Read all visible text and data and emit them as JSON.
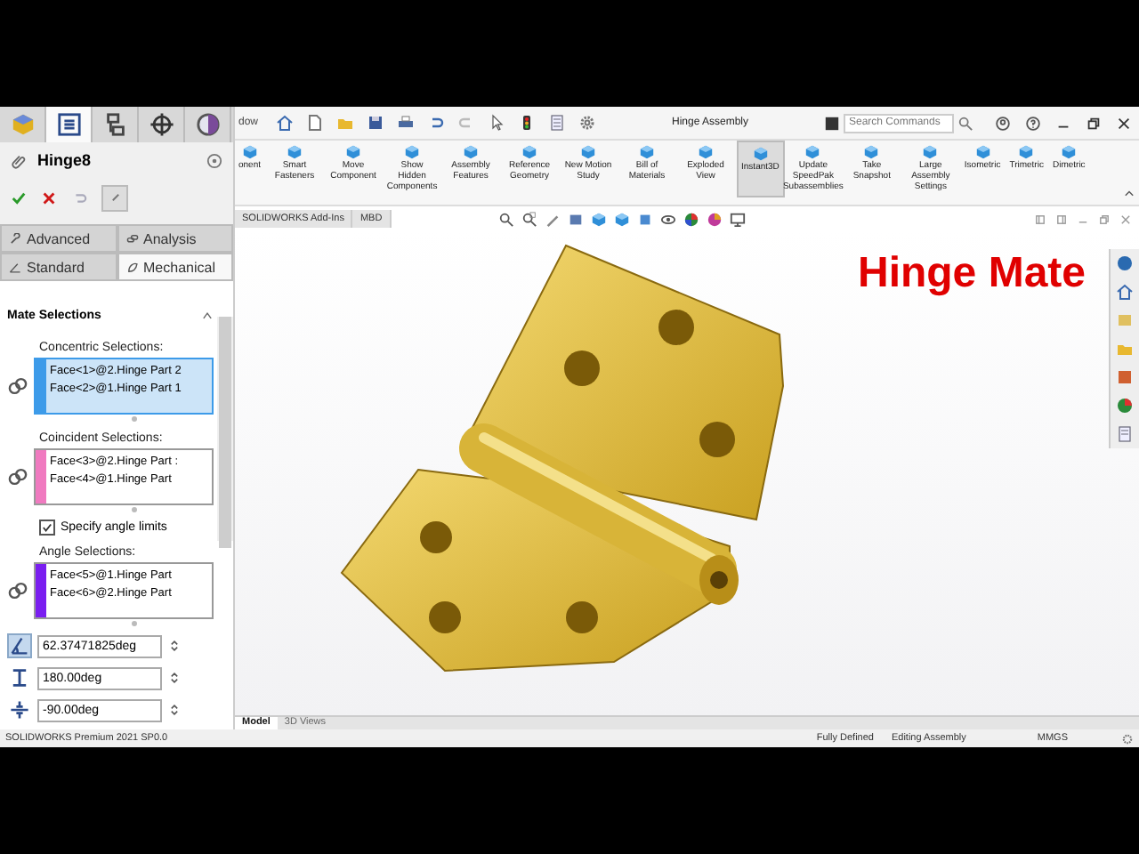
{
  "menu_fragment": "dow",
  "title": "Hinge Assembly",
  "search": {
    "placeholder": "Search Commands"
  },
  "panel_tabs": [
    {
      "kind": "feature",
      "selected": false
    },
    {
      "kind": "property",
      "selected": true
    },
    {
      "kind": "config",
      "selected": false
    },
    {
      "kind": "dim",
      "selected": false
    },
    {
      "kind": "display",
      "selected": false
    }
  ],
  "feature": {
    "title": "Hinge8"
  },
  "mate_tabs": [
    {
      "label": "Advanced",
      "kind": "advanced",
      "selected": false
    },
    {
      "label": "Analysis",
      "kind": "analysis",
      "selected": false
    },
    {
      "label": "Standard",
      "kind": "standard",
      "selected": false
    },
    {
      "label": "Mechanical",
      "kind": "mechanical",
      "selected": true
    }
  ],
  "section": {
    "title": "Mate Selections",
    "expanded": true
  },
  "selections": [
    {
      "kind": "group",
      "label": "Concentric Selections:",
      "color": "#3d9be9",
      "selected": true,
      "items": [
        "Face<1>@2.Hinge Part 2",
        "Face<2>@1.Hinge Part 1"
      ]
    },
    {
      "kind": "group",
      "label": "Coincident Selections:",
      "color": "#f07ac0",
      "selected": false,
      "items": [
        "Face<3>@2.Hinge Part :",
        "Face<4>@1.Hinge Part"
      ]
    },
    {
      "kind": "checkbox",
      "label": "Specify angle limits",
      "checked": true
    },
    {
      "kind": "group",
      "label": "Angle Selections:",
      "color": "#7a1ef0",
      "selected": false,
      "items": [
        "Face<5>@1.Hinge Part",
        "Face<6>@2.Hinge Part"
      ]
    }
  ],
  "values": [
    {
      "kind": "angle",
      "value": "62.37471825deg",
      "selected": true
    },
    {
      "kind": "max",
      "value": "180.00deg",
      "selected": false
    },
    {
      "kind": "min",
      "value": "-90.00deg",
      "selected": false
    }
  ],
  "ribbon": [
    {
      "label": "onent",
      "selected": false
    },
    {
      "label": "Smart Fasteners",
      "selected": false
    },
    {
      "label": "Move Component",
      "selected": false
    },
    {
      "label": "Show Hidden Components",
      "selected": false
    },
    {
      "label": "Assembly Features",
      "selected": false
    },
    {
      "label": "Reference Geometry",
      "selected": false
    },
    {
      "label": "New Motion Study",
      "selected": false
    },
    {
      "label": "Bill of Materials",
      "selected": false
    },
    {
      "label": "Exploded View",
      "selected": false
    },
    {
      "label": "Instant3D",
      "selected": true
    },
    {
      "label": "Update SpeedPak Subassemblies",
      "selected": false
    },
    {
      "label": "Take Snapshot",
      "selected": false
    },
    {
      "label": "Large Assembly Settings",
      "selected": false
    },
    {
      "label": "Isometric",
      "selected": false
    },
    {
      "label": "Trimetric",
      "selected": false
    },
    {
      "label": "Dimetric",
      "selected": false
    }
  ],
  "command_tabs": [
    {
      "label": "SOLIDWORKS Add-Ins",
      "selected": false
    },
    {
      "label": "MBD",
      "selected": false
    }
  ],
  "overlay_title": "Hinge Mate",
  "model_tabs": [
    {
      "label": "Model",
      "selected": true
    },
    {
      "label": "3D Views",
      "selected": false
    }
  ],
  "status_bar": {
    "product": "SOLIDWORKS Premium 2021 SP0.0",
    "state": "Fully Defined",
    "mode": "Editing Assembly",
    "units": "MMGS"
  }
}
